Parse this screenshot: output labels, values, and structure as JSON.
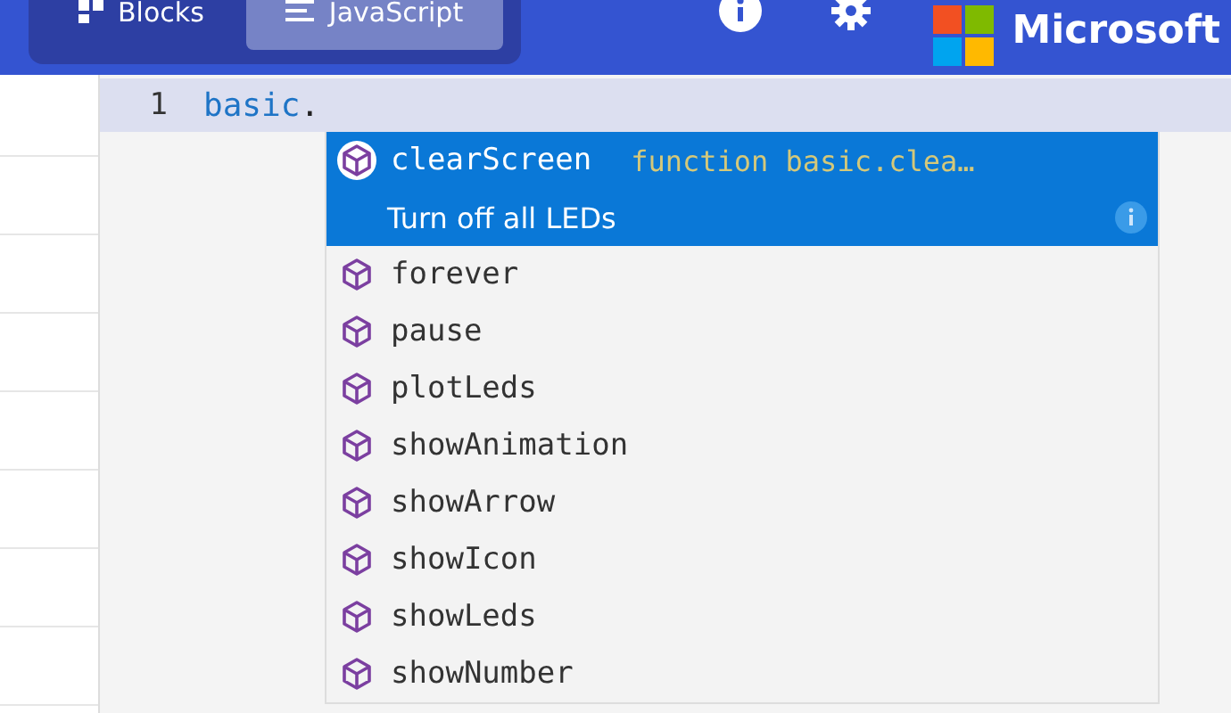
{
  "header": {
    "tabs": [
      {
        "label": "Blocks",
        "selected": false
      },
      {
        "label": "JavaScript",
        "selected": true
      }
    ],
    "brand": "Microsoft"
  },
  "editor": {
    "lines": [
      {
        "number": "1",
        "current": true,
        "tokens": [
          {
            "text": "basic",
            "kind": "identifier"
          },
          {
            "text": ".",
            "kind": "punctuation"
          }
        ]
      }
    ]
  },
  "suggestions": [
    {
      "label": "clearScreen",
      "selected": true,
      "detail": "function basic.clea…",
      "description": "Turn off all LEDs"
    },
    {
      "label": "forever",
      "selected": false
    },
    {
      "label": "pause",
      "selected": false
    },
    {
      "label": "plotLeds",
      "selected": false
    },
    {
      "label": "showAnimation",
      "selected": false
    },
    {
      "label": "showArrow",
      "selected": false
    },
    {
      "label": "showIcon",
      "selected": false
    },
    {
      "label": "showLeds",
      "selected": false
    },
    {
      "label": "showNumber",
      "selected": false
    }
  ]
}
